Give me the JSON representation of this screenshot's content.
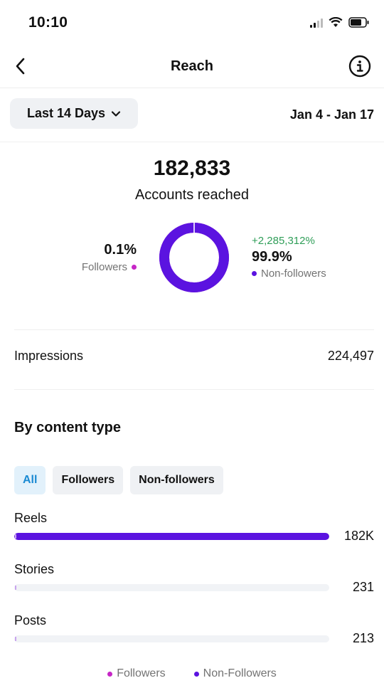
{
  "status_bar": {
    "time": "10:10"
  },
  "header": {
    "title": "Reach"
  },
  "period": {
    "label": "Last 14 Days",
    "date_range": "Jan 4 - Jan 17"
  },
  "reach": {
    "value": "182,833",
    "label": "Accounts reached",
    "followers_pct": "0.1%",
    "followers_label": "Followers",
    "nonfollowers_change": "+2,285,312%",
    "nonfollowers_pct": "99.9%",
    "nonfollowers_label": "Non-followers",
    "donut_nonfollowers_fraction": 0.999
  },
  "impressions": {
    "label": "Impressions",
    "value": "224,497"
  },
  "content_type": {
    "title": "By content type",
    "filters": [
      "All",
      "Followers",
      "Non-followers"
    ],
    "active_filter": "All",
    "rows": [
      {
        "label": "Reels",
        "value": "182K",
        "fraction": 1.0
      },
      {
        "label": "Stories",
        "value": "231",
        "fraction": 0.0013
      },
      {
        "label": "Posts",
        "value": "213",
        "fraction": 0.0012
      }
    ]
  },
  "legend": {
    "followers": "Followers",
    "nonfollowers": "Non-Followers"
  },
  "colors": {
    "followers": "#c626c6",
    "nonfollowers": "#5b13e0",
    "positive": "#2f9e58",
    "active_chip": "#1a8ad3"
  }
}
